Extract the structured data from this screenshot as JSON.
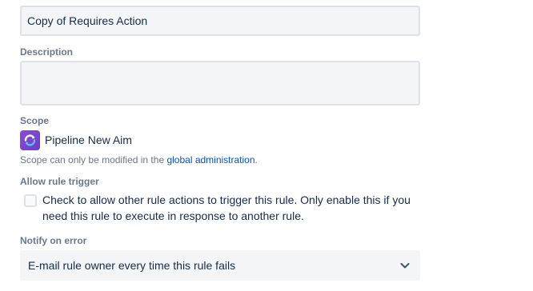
{
  "rule_name": {
    "value": "Copy of Requires Action"
  },
  "description": {
    "label": "Description",
    "value": ""
  },
  "scope": {
    "label": "Scope",
    "project_name": "Pipeline New Aim",
    "project_icon": "project-avatar-icon",
    "helper_prefix": "Scope can only be modified in the",
    "helper_link": "global administration",
    "helper_suffix": "."
  },
  "allow_rule_trigger": {
    "label": "Allow rule trigger",
    "checked": false,
    "text": "Check to allow other rule actions to trigger this rule. Only enable this if you need this rule to execute in response to another rule."
  },
  "notify_on_error": {
    "label": "Notify on error",
    "selected": "E-mail rule owner every time this rule fails",
    "icon": "chevron-down-icon"
  }
}
